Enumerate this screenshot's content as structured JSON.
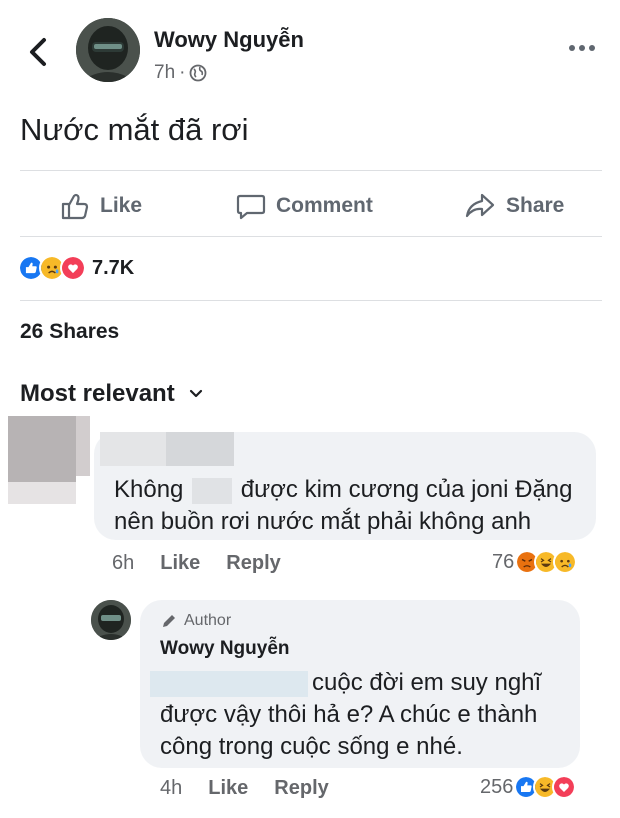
{
  "post": {
    "author": "Wowy Nguyễn",
    "time": "7h",
    "text": "Nước mắt đã rơi"
  },
  "actions": {
    "like": "Like",
    "comment": "Comment",
    "share": "Share"
  },
  "stats": {
    "reactions_count": "7.7K",
    "shares": "26 Shares"
  },
  "sort": {
    "label": "Most relevant"
  },
  "comments": [
    {
      "text_part1": "Không",
      "text_part2": "được kim cương của joni Đặng",
      "text_line2": "nên buồn rơi nước mắt phải không anh",
      "time": "6h",
      "like_label": "Like",
      "reply_label": "Reply",
      "reaction_count": "76"
    },
    {
      "badge": "Author",
      "author": "Wowy Nguyễn",
      "line1": "cuộc đời em suy nghĩ",
      "line2": "được vậy thôi hả e? A chúc e thành",
      "line3": "công trong cuộc sống e nhé.",
      "time": "4h",
      "like_label": "Like",
      "reply_label": "Reply",
      "reaction_count": "256"
    }
  ],
  "colors": {
    "like_blue": "#1877f2",
    "love_red": "#f33e58",
    "haha_yellow": "#f7b928",
    "angry_orange": "#e9710f",
    "text_grey": "#65676b",
    "bubble_bg": "#f0f2f5"
  },
  "icons": {
    "back": "chevron-left-icon",
    "more": "more-horizontal-icon",
    "globe": "globe-icon",
    "like": "thumbs-up-icon",
    "comment": "speech-bubble-icon",
    "share": "share-arrow-icon",
    "author_badge": "pencil-icon"
  }
}
